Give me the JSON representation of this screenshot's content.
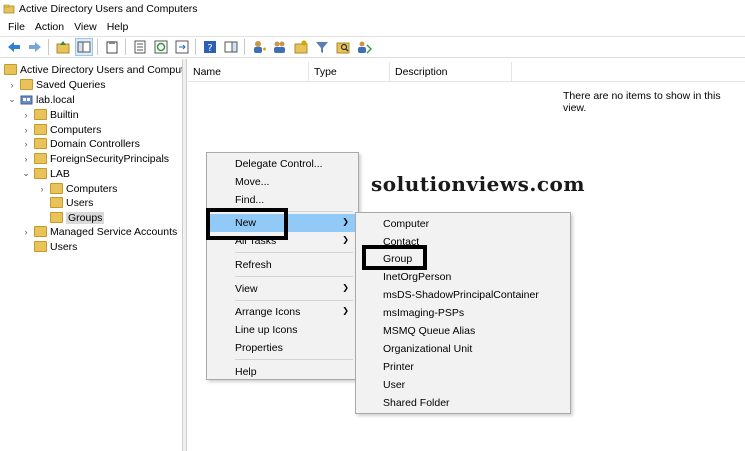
{
  "window": {
    "title": "Active Directory Users and Computers"
  },
  "menubar": {
    "items": [
      "File",
      "Action",
      "View",
      "Help"
    ]
  },
  "tree": {
    "root": "Active Directory Users and Computers",
    "saved_queries": "Saved Queries",
    "domain": "lab.local",
    "builtin": "Builtin",
    "computers": "Computers",
    "domain_controllers": "Domain Controllers",
    "foreign": "ForeignSecurityPrincipals",
    "lab": "LAB",
    "lab_computers": "Computers",
    "lab_users": "Users",
    "lab_groups": "Groups",
    "msa": "Managed Service Accounts",
    "users": "Users"
  },
  "list": {
    "columns": [
      "Name",
      "Type",
      "Description"
    ],
    "empty_message": "There are no items to show in this view."
  },
  "watermark": "solutionviews.com",
  "context_menu": {
    "delegate": "Delegate Control...",
    "move": "Move...",
    "find": "Find...",
    "new": "New",
    "all_tasks": "All Tasks",
    "refresh": "Refresh",
    "view": "View",
    "arrange": "Arrange Icons",
    "lineup": "Line up Icons",
    "properties": "Properties",
    "help": "Help"
  },
  "submenu": {
    "items": [
      "Computer",
      "Contact",
      "Group",
      "InetOrgPerson",
      "msDS-ShadowPrincipalContainer",
      "msImaging-PSPs",
      "MSMQ Queue Alias",
      "Organizational Unit",
      "Printer",
      "User",
      "Shared Folder"
    ]
  },
  "colors": {
    "highlight": "#91c9f7",
    "folder": "#e7c35a",
    "menu_bg": "#f2f2f2"
  }
}
